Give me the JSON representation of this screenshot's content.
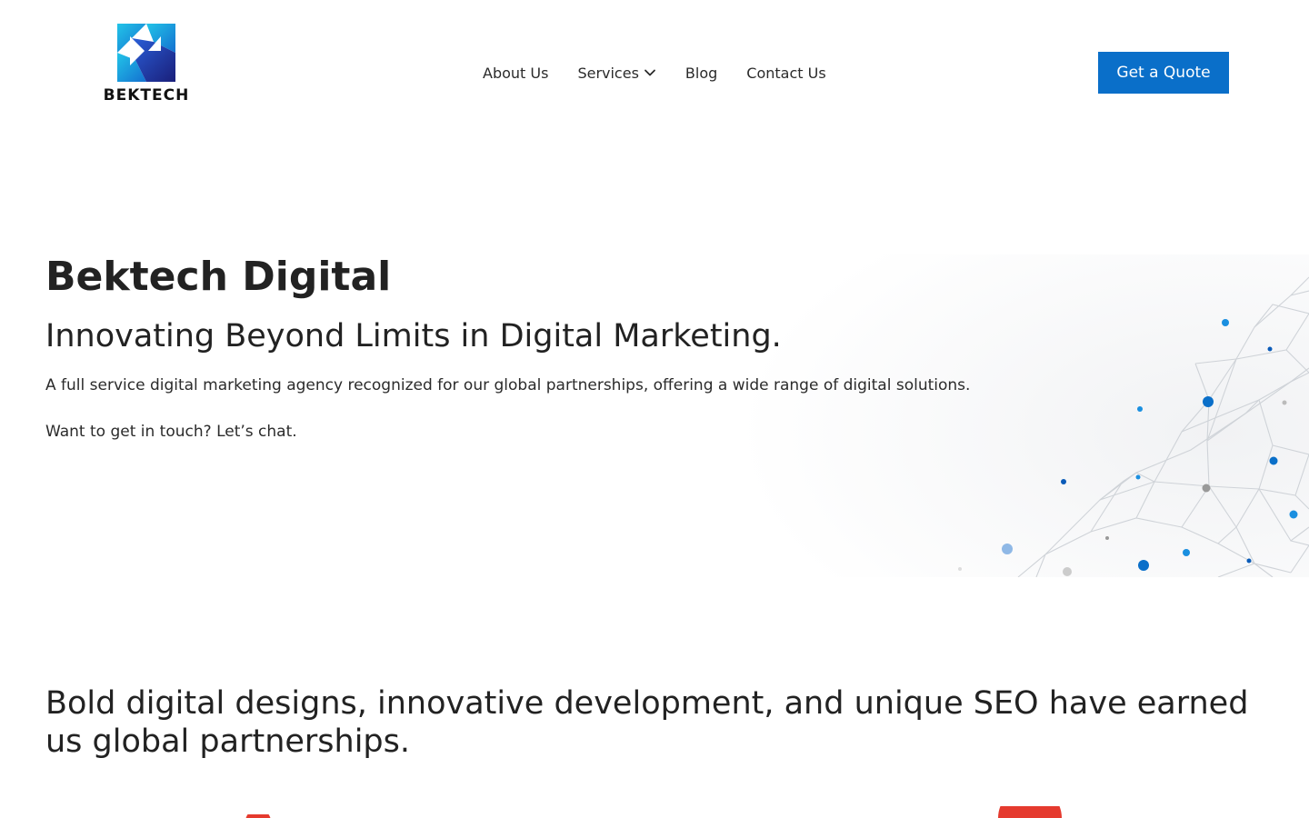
{
  "header": {
    "logo_text": "BEKTECH",
    "nav": {
      "about": "About Us",
      "services": "Services",
      "blog": "Blog",
      "contact": "Contact Us"
    },
    "cta_label": "Get a Quote"
  },
  "hero": {
    "title": "Bektech Digital",
    "subtitle": "Innovating Beyond Limits in Digital Marketing.",
    "description": "A full service digital marketing agency recognized for our global partnerships, offering a wide range of digital solutions.",
    "cta_text": "Want to get in touch? Let’s chat."
  },
  "section": {
    "heading": "Bold digital designs, innovative development, and unique SEO have earned us global partnerships."
  },
  "colors": {
    "accent": "#0a6fc9",
    "text": "#222222",
    "partner_red": "#e53a2e"
  },
  "icons": {
    "logo": "bektech-logo-icon",
    "dropdown": "chevron-down-icon"
  }
}
